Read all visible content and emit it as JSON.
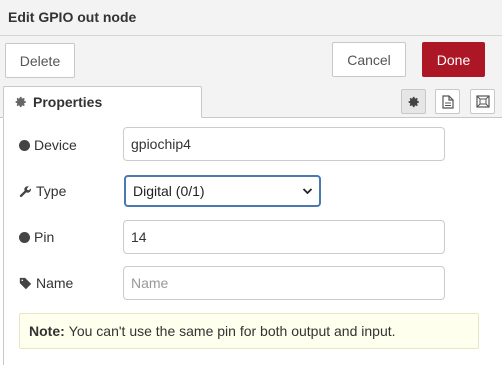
{
  "dialog": {
    "title": "Edit GPIO out node"
  },
  "toolbar": {
    "delete_label": "Delete",
    "cancel_label": "Cancel",
    "done_label": "Done"
  },
  "tabs": {
    "properties_label": "Properties",
    "icons": [
      "gear-icon",
      "document-icon",
      "frame-icon"
    ]
  },
  "form": {
    "device": {
      "label": "Device",
      "value": "gpiochip4"
    },
    "type": {
      "label": "Type",
      "value": "Digital (0/1)"
    },
    "pin": {
      "label": "Pin",
      "value": "14"
    },
    "name": {
      "label": "Name",
      "placeholder": "Name",
      "value": ""
    }
  },
  "note": {
    "prefix": "Note:",
    "text": "You can't use the same pin for both output and input."
  },
  "colors": {
    "done_button": "#ad1625",
    "select_focus": "#4a78b5",
    "note_bg": "#ffffee"
  }
}
